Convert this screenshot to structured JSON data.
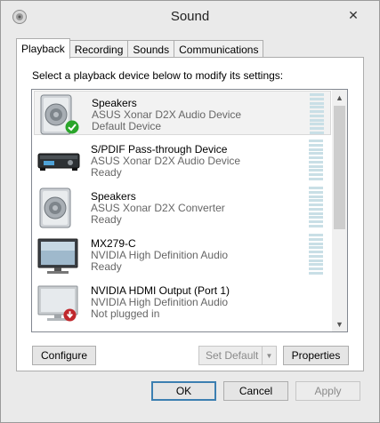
{
  "window": {
    "title": "Sound"
  },
  "tabs": [
    {
      "label": "Playback",
      "active": true
    },
    {
      "label": "Recording",
      "active": false
    },
    {
      "label": "Sounds",
      "active": false
    },
    {
      "label": "Communications",
      "active": false
    }
  ],
  "instruction": "Select a playback device below to modify its settings:",
  "devices": [
    {
      "name": "Speakers",
      "driver": "ASUS Xonar D2X Audio Device",
      "status": "Default Device",
      "icon": "speaker-icon",
      "badge": "default-check-icon",
      "selected": true
    },
    {
      "name": "S/PDIF Pass-through Device",
      "driver": "ASUS Xonar D2X Audio Device",
      "status": "Ready",
      "icon": "receiver-icon",
      "badge": null,
      "selected": false
    },
    {
      "name": "Speakers",
      "driver": "ASUS Xonar D2X Converter",
      "status": "Ready",
      "icon": "speaker-icon",
      "badge": null,
      "selected": false
    },
    {
      "name": "MX279-C",
      "driver": "NVIDIA High Definition Audio",
      "status": "Ready",
      "icon": "monitor-icon",
      "badge": null,
      "selected": false
    },
    {
      "name": "NVIDIA HDMI Output (Port 1)",
      "driver": "NVIDIA High Definition Audio",
      "status": "Not plugged in",
      "icon": "monitor-icon",
      "badge": "unplugged-icon",
      "selected": false
    }
  ],
  "buttons": {
    "configure": "Configure",
    "set_default": "Set Default",
    "properties": "Properties",
    "ok": "OK",
    "cancel": "Cancel",
    "apply": "Apply"
  },
  "colors": {
    "accent": "#3c7fb1",
    "check": "#2aa52a",
    "unplugged": "#c0282d",
    "meter": "#c9dfe6"
  }
}
